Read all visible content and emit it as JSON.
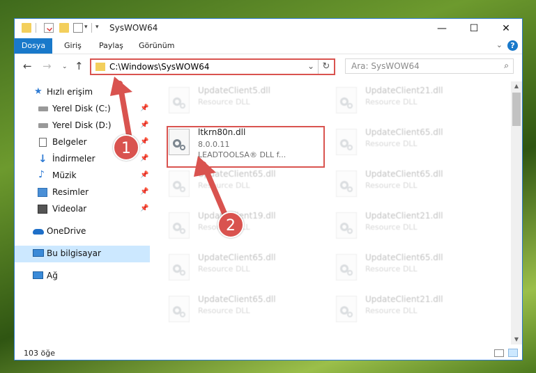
{
  "window": {
    "title": "SysWOW64",
    "minimize_glyph": "—",
    "maximize_glyph": "☐",
    "close_glyph": "✕"
  },
  "ribbon": {
    "tabs": [
      "Dosya",
      "Giriş",
      "Paylaş",
      "Görünüm"
    ],
    "help_glyph": "?"
  },
  "nav": {
    "address_path": "C:\\Windows\\SysWOW64",
    "search_placeholder": "Ara: SysWOW64"
  },
  "sidebar": {
    "items": [
      {
        "label": "Hızlı erişim",
        "icon": "star-icon"
      },
      {
        "label": "Yerel Disk (C:)",
        "icon": "drive-icon",
        "pinned": true
      },
      {
        "label": "Yerel Disk (D:)",
        "icon": "drive-icon",
        "pinned": true
      },
      {
        "label": "Belgeler",
        "icon": "documents-icon",
        "pinned": true
      },
      {
        "label": "İndirmeler",
        "icon": "download-icon",
        "pinned": true
      },
      {
        "label": "Müzik",
        "icon": "music-icon",
        "pinned": true
      },
      {
        "label": "Resimler",
        "icon": "pictures-icon",
        "pinned": true
      },
      {
        "label": "Videolar",
        "icon": "videos-icon",
        "pinned": true
      },
      {
        "label": "OneDrive",
        "icon": "cloud-icon"
      },
      {
        "label": "Bu bilgisayar",
        "icon": "computer-icon",
        "selected": true
      },
      {
        "label": "Ağ",
        "icon": "network-icon"
      }
    ]
  },
  "files": {
    "highlighted": {
      "name": "ltkrn80n.dll",
      "version": "8.0.0.11",
      "description": "LEADTOOLSA® DLL f..."
    },
    "left_column": [
      {
        "name": "UpdateClient5.dll",
        "type": "Resource DLL"
      },
      {
        "name": "UpdateClient65.dll",
        "type": "Resource DLL"
      },
      {
        "name": "UpdateClient19.dll",
        "type": "Resource DLL"
      },
      {
        "name": "UpdateClient65.dll",
        "type": "Resource DLL"
      },
      {
        "name": "UpdateClient65.dll",
        "type": "Resource DLL"
      }
    ],
    "right_column": [
      {
        "name": "UpdateClient21.dll",
        "type": "Resource DLL"
      },
      {
        "name": "UpdateClient65.dll",
        "type": "Resource DLL"
      },
      {
        "name": "UpdateClient65.dll",
        "type": "Resource DLL"
      },
      {
        "name": "UpdateClient21.dll",
        "type": "Resource DLL"
      },
      {
        "name": "UpdateClient65.dll",
        "type": "Resource DLL"
      },
      {
        "name": "UpdateClient21.dll",
        "type": "Resource DLL"
      }
    ]
  },
  "status": {
    "count": "103 öğe"
  },
  "annotations": {
    "step1": "1",
    "step2": "2",
    "color": "#d9534f"
  }
}
